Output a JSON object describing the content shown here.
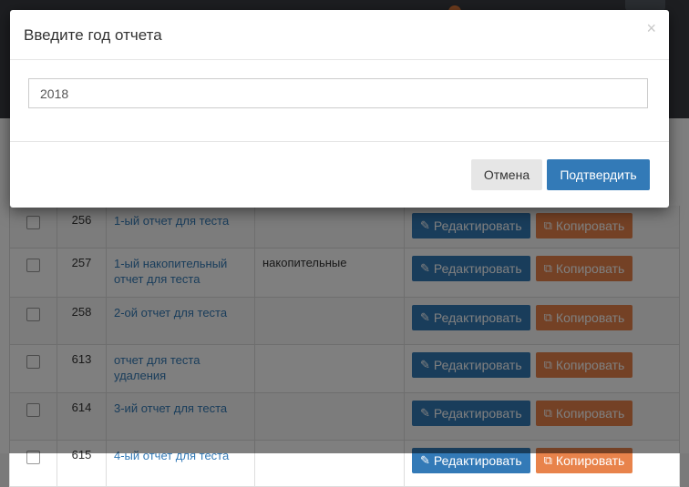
{
  "modal": {
    "title": "Введите год отчета",
    "close_glyph": "×",
    "year_value": "2018",
    "cancel_label": "Отмена",
    "confirm_label": "Подтвердить"
  },
  "table": {
    "edit_label": "Редактировать",
    "copy_label": "Копировать",
    "rows": [
      {
        "id": "256",
        "name": "1-ый отчет для теста",
        "type": ""
      },
      {
        "id": "257",
        "name": "1-ый накопительный отчет для теста",
        "type": "накопительные"
      },
      {
        "id": "258",
        "name": "2-ой отчет для теста",
        "type": ""
      },
      {
        "id": "613",
        "name": "отчет для теста удаления",
        "type": ""
      },
      {
        "id": "614",
        "name": "3-ий отчет для теста",
        "type": ""
      },
      {
        "id": "615",
        "name": "4-ый отчет для теста",
        "type": ""
      }
    ]
  },
  "icons": {
    "edit": "edit-icon",
    "copy": "copy-icon",
    "close": "close-icon"
  },
  "colors": {
    "primary": "#337ab7",
    "copy": "#e8834b",
    "overlay": "rgba(0,0,0,0.5)"
  }
}
